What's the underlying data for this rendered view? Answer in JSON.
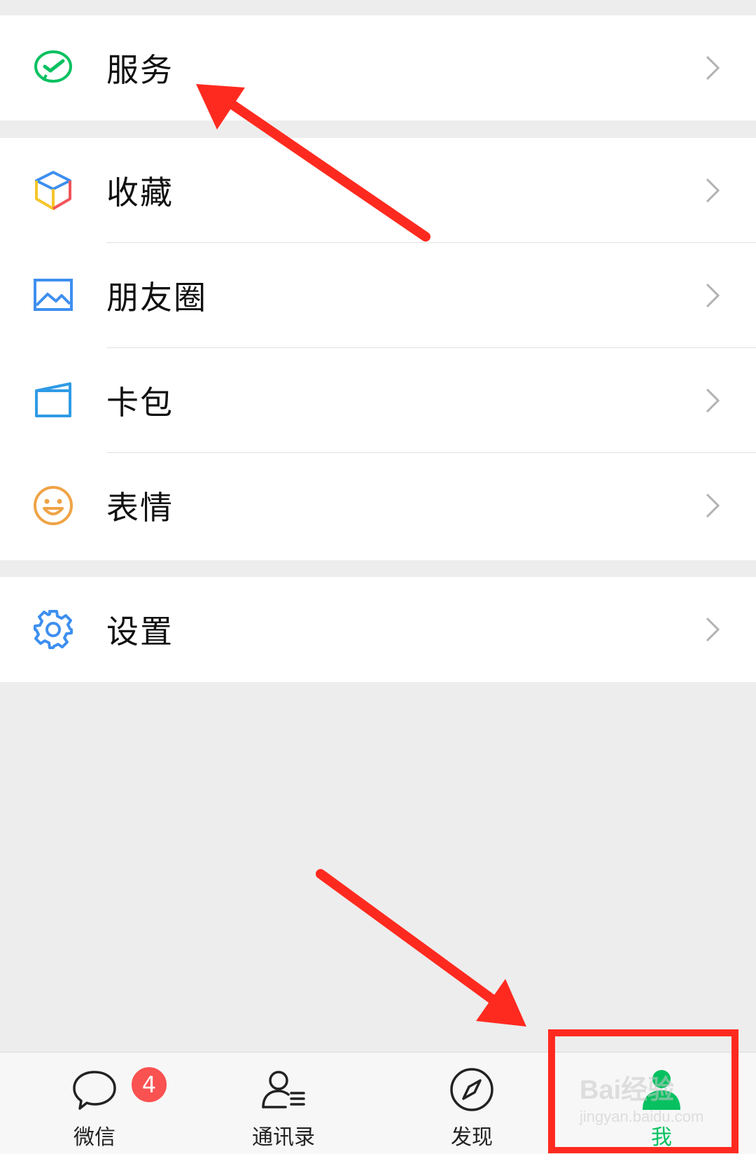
{
  "colors": {
    "accent": "#07c160",
    "badge": "#fa5151",
    "annotation": "#ff2a1f",
    "background": "#ededed"
  },
  "menu": {
    "service": {
      "label": "服务",
      "icon": "wechat-pay-check-icon"
    },
    "favorites": {
      "label": "收藏",
      "icon": "cube-icon"
    },
    "moments": {
      "label": "朋友圈",
      "icon": "picture-icon"
    },
    "cards": {
      "label": "卡包",
      "icon": "wallet-card-icon"
    },
    "stickers": {
      "label": "表情",
      "icon": "smiley-icon"
    },
    "settings": {
      "label": "设置",
      "icon": "gear-icon"
    }
  },
  "tabbar": {
    "tabs": [
      {
        "label": "微信",
        "icon": "chat-bubble-icon",
        "badge": "4"
      },
      {
        "label": "通讯录",
        "icon": "contacts-icon"
      },
      {
        "label": "发现",
        "icon": "compass-icon"
      },
      {
        "label": "我",
        "icon": "person-icon",
        "active": true
      }
    ]
  },
  "watermark": {
    "line1": "Bai经验",
    "line2": "jingyan.baidu.com"
  }
}
